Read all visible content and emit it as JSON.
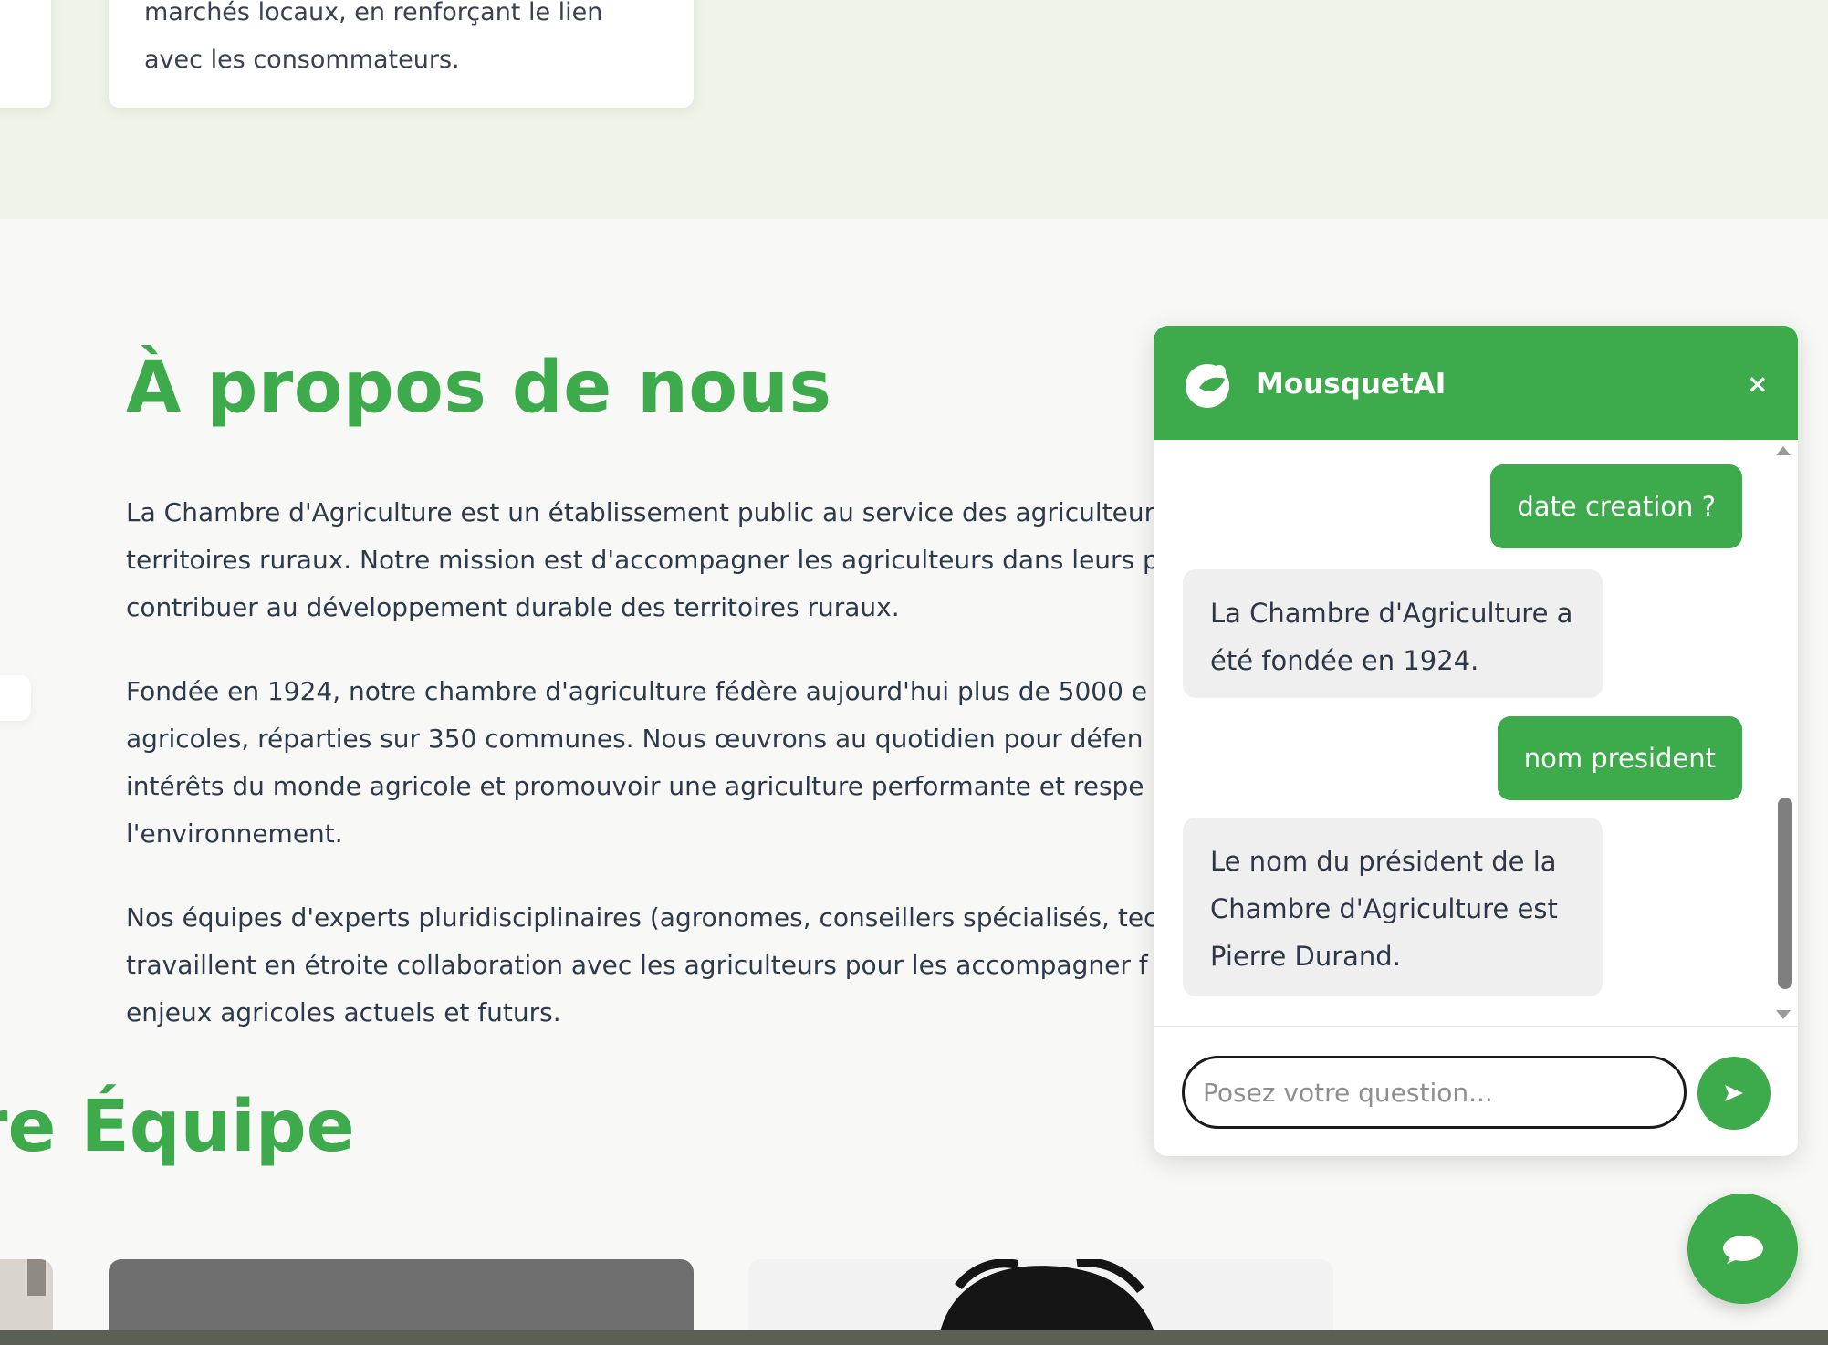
{
  "prev_section": {
    "card_text_lines": [
      "marchés locaux, en renforçant le lien",
      "avec les consommateurs."
    ]
  },
  "about": {
    "title": "À propos de nous",
    "paragraphs": [
      [
        "La Chambre d'Agriculture est un établissement public au service des agriculteurs",
        "territoires ruraux. Notre mission est d'accompagner les agriculteurs dans leurs p",
        "contribuer au développement durable des territoires ruraux."
      ],
      [
        "Fondée en 1924, notre chambre d'agriculture fédère aujourd'hui plus de 5000 e",
        "agricoles, réparties sur 350 communes. Nous œuvrons au quotidien pour défen",
        "intérêts du monde agricole et promouvoir une agriculture performante et respe",
        "l'environnement."
      ],
      [
        "Nos équipes d'experts pluridisciplinaires (agronomes, conseillers spécialisés, tec",
        "travaillent en étroite collaboration avec les agriculteurs pour les accompagner f",
        "enjeux agricoles actuels et futurs."
      ]
    ]
  },
  "team": {
    "title": "re Équipe"
  },
  "chat": {
    "title": "MousquetAI",
    "close_label": "×",
    "messages": [
      {
        "role": "user",
        "text": "date creation ?"
      },
      {
        "role": "bot",
        "text": "La Chambre d'Agriculture a été fondée en 1924."
      },
      {
        "role": "user",
        "text": "nom president"
      },
      {
        "role": "bot",
        "text": "Le nom du président de la Chambre d'Agriculture est Pierre Durand."
      }
    ],
    "input_placeholder": "Posez votre question...",
    "send_icon": "send-arrow-icon",
    "toggle_icon": "chat-bubble-icon"
  },
  "colors": {
    "brand_green": "#3daa4c",
    "top_band": "#eef5e8",
    "page_bg": "#f8f9f7",
    "bot_bubble": "#efefef"
  }
}
